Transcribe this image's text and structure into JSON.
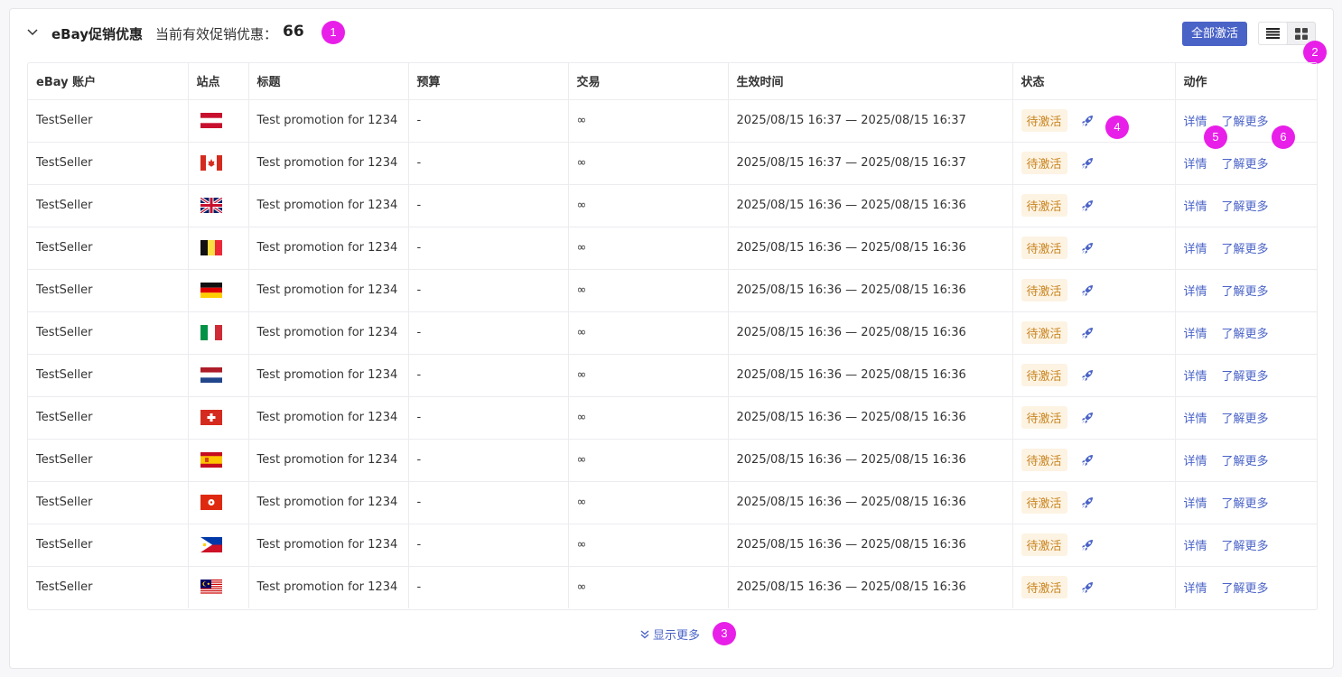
{
  "header": {
    "title": "eBay促销优惠",
    "subtitle": "当前有效促销优惠：",
    "count": "66",
    "activate_all_label": "全部激活"
  },
  "markers": [
    "1",
    "2",
    "3",
    "4",
    "5",
    "6"
  ],
  "table": {
    "columns": [
      "eBay 账户",
      "站点",
      "标题",
      "预算",
      "交易",
      "生效时间",
      "状态",
      "动作"
    ],
    "rows": [
      {
        "account": "TestSeller",
        "site": "AT",
        "title": "Test promotion for 1234",
        "budget": "-",
        "deals": "∞",
        "period": "2025/08/15 16:37 — 2025/08/15 16:37",
        "status": "待激活",
        "detail": "详情",
        "more": "了解更多"
      },
      {
        "account": "TestSeller",
        "site": "CA",
        "title": "Test promotion for 1234",
        "budget": "-",
        "deals": "∞",
        "period": "2025/08/15 16:37 — 2025/08/15 16:37",
        "status": "待激活",
        "detail": "详情",
        "more": "了解更多"
      },
      {
        "account": "TestSeller",
        "site": "UK",
        "title": "Test promotion for 1234",
        "budget": "-",
        "deals": "∞",
        "period": "2025/08/15 16:36 — 2025/08/15 16:36",
        "status": "待激活",
        "detail": "详情",
        "more": "了解更多"
      },
      {
        "account": "TestSeller",
        "site": "BE",
        "title": "Test promotion for 1234",
        "budget": "-",
        "deals": "∞",
        "period": "2025/08/15 16:36 — 2025/08/15 16:36",
        "status": "待激活",
        "detail": "详情",
        "more": "了解更多"
      },
      {
        "account": "TestSeller",
        "site": "DE",
        "title": "Test promotion for 1234",
        "budget": "-",
        "deals": "∞",
        "period": "2025/08/15 16:36 — 2025/08/15 16:36",
        "status": "待激活",
        "detail": "详情",
        "more": "了解更多"
      },
      {
        "account": "TestSeller",
        "site": "IT",
        "title": "Test promotion for 1234",
        "budget": "-",
        "deals": "∞",
        "period": "2025/08/15 16:36 — 2025/08/15 16:36",
        "status": "待激活",
        "detail": "详情",
        "more": "了解更多"
      },
      {
        "account": "TestSeller",
        "site": "NL",
        "title": "Test promotion for 1234",
        "budget": "-",
        "deals": "∞",
        "period": "2025/08/15 16:36 — 2025/08/15 16:36",
        "status": "待激活",
        "detail": "详情",
        "more": "了解更多"
      },
      {
        "account": "TestSeller",
        "site": "CH",
        "title": "Test promotion for 1234",
        "budget": "-",
        "deals": "∞",
        "period": "2025/08/15 16:36 — 2025/08/15 16:36",
        "status": "待激活",
        "detail": "详情",
        "more": "了解更多"
      },
      {
        "account": "TestSeller",
        "site": "ES",
        "title": "Test promotion for 1234",
        "budget": "-",
        "deals": "∞",
        "period": "2025/08/15 16:36 — 2025/08/15 16:36",
        "status": "待激活",
        "detail": "详情",
        "more": "了解更多"
      },
      {
        "account": "TestSeller",
        "site": "HK",
        "title": "Test promotion for 1234",
        "budget": "-",
        "deals": "∞",
        "period": "2025/08/15 16:36 — 2025/08/15 16:36",
        "status": "待激活",
        "detail": "详情",
        "more": "了解更多"
      },
      {
        "account": "TestSeller",
        "site": "PH",
        "title": "Test promotion for 1234",
        "budget": "-",
        "deals": "∞",
        "period": "2025/08/15 16:36 — 2025/08/15 16:36",
        "status": "待激活",
        "detail": "详情",
        "more": "了解更多"
      },
      {
        "account": "TestSeller",
        "site": "MY",
        "title": "Test promotion for 1234",
        "budget": "-",
        "deals": "∞",
        "period": "2025/08/15 16:36 — 2025/08/15 16:36",
        "status": "待激活",
        "detail": "详情",
        "more": "了解更多"
      }
    ]
  },
  "footer": {
    "show_more_label": "显示更多"
  },
  "colors": {
    "accent": "#4a63c7",
    "pending_bg": "#fdf3e3",
    "pending_text": "#c88520",
    "marker": "#e81fe8"
  },
  "icons": {
    "collapse": "chevron-down-icon",
    "list_view": "list-view-icon",
    "grid_view": "grid-view-icon",
    "status_action": "rocket-icon",
    "show_more": "double-chevron-down-icon"
  }
}
